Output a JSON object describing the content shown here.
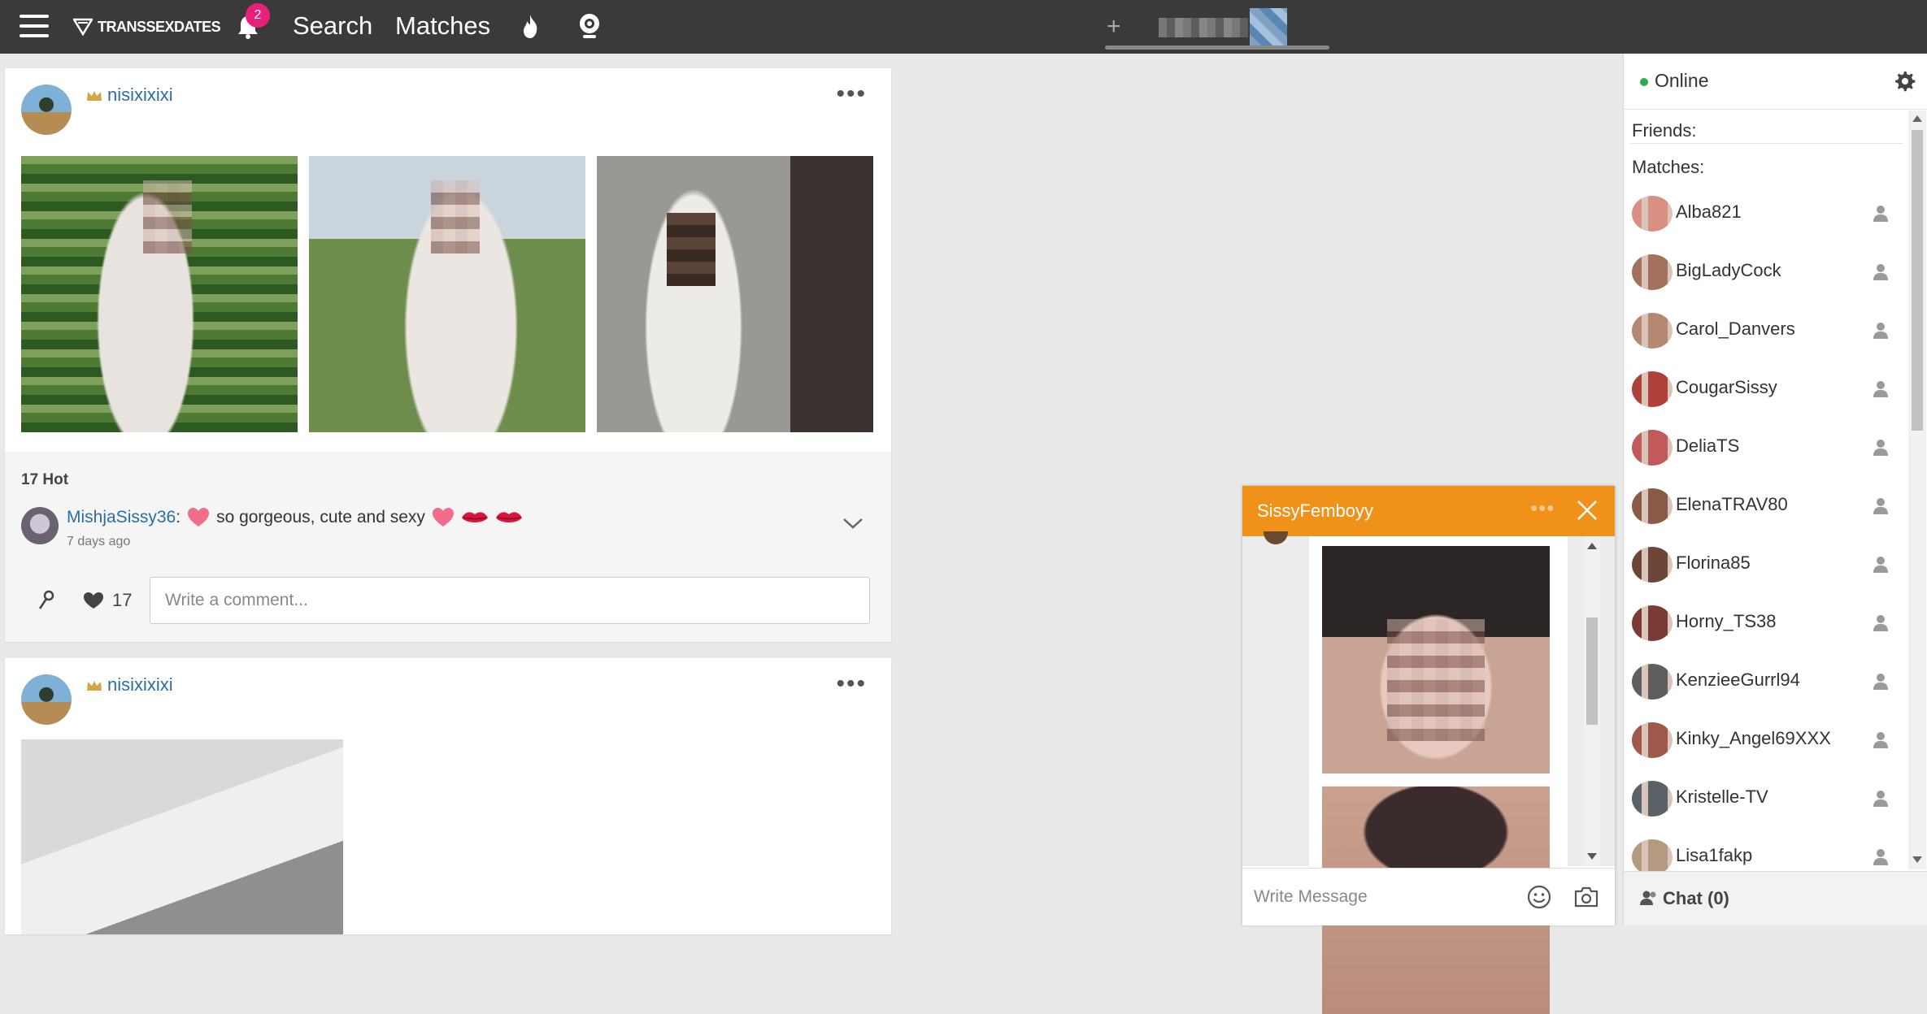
{
  "header": {
    "logo_text": "TRANSSEXDATES",
    "notification_count": "2",
    "nav_search": "Search",
    "nav_matches": "Matches"
  },
  "feed": {
    "post1": {
      "username": "nisixixixi",
      "hot_count": "17 Hot",
      "comment": {
        "user": "MishjaSissy36",
        "separator": ":",
        "text": "so gorgeous, cute and sexy",
        "time": "7 days ago"
      },
      "like_count": "17",
      "comment_placeholder": "Write a comment..."
    },
    "post2": {
      "username": "nisixixixi"
    }
  },
  "sidebar": {
    "status_label": "Online",
    "friends_label": "Friends:",
    "matches_label": "Matches:",
    "matches": [
      {
        "name": "Alba821",
        "avatar_color": "#d98f82"
      },
      {
        "name": "BigLadyCock",
        "avatar_color": "#a3725e"
      },
      {
        "name": "Carol_Danvers",
        "avatar_color": "#b58872"
      },
      {
        "name": "CougarSissy",
        "avatar_color": "#b0403a"
      },
      {
        "name": "DeliaTS",
        "avatar_color": "#c15a5a"
      },
      {
        "name": "ElenaTRAV80",
        "avatar_color": "#8a5a48"
      },
      {
        "name": "Florina85",
        "avatar_color": "#6e4638"
      },
      {
        "name": "Horny_TS38",
        "avatar_color": "#7a3a36"
      },
      {
        "name": "KenzieeGurrl94",
        "avatar_color": "#5e5e5e"
      },
      {
        "name": "Kinky_Angel69XXX",
        "avatar_color": "#a0584a"
      },
      {
        "name": "Kristelle-TV",
        "avatar_color": "#5a6268"
      },
      {
        "name": "Lisa1fakp",
        "avatar_color": "#b49a80"
      }
    ],
    "chat_label": "Chat (0)"
  },
  "chat_popup": {
    "title": "SissyFemboyy",
    "input_placeholder": "Write Message"
  },
  "colors": {
    "topbar": "#3a3a3a",
    "link": "#2a6ea3",
    "chat_header": "#f0911a",
    "badge": "#e8207a",
    "online": "#2eaa4f"
  }
}
